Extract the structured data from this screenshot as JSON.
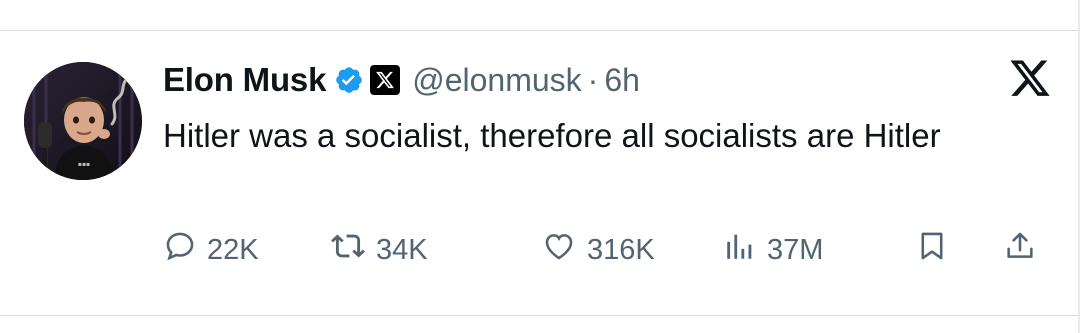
{
  "tweet": {
    "author_name": "Elon Musk",
    "handle": "@elonmusk",
    "separator": "·",
    "time": "6h",
    "text": "Hitler was a socialist, therefore all socialists are Hitler"
  },
  "actions": {
    "replies": "22K",
    "reposts": "34K",
    "likes": "316K",
    "views": "37M"
  },
  "icons": {
    "verified": "verified-badge-icon",
    "affiliation": "x-affiliation-icon",
    "platform": "x-logo-icon",
    "reply": "reply-icon",
    "repost": "repost-icon",
    "like": "heart-icon",
    "views": "views-icon",
    "bookmark": "bookmark-icon",
    "share": "share-icon"
  },
  "colors": {
    "text": "#0f1419",
    "secondary": "#536471",
    "verified_blue": "#1d9bf0"
  }
}
